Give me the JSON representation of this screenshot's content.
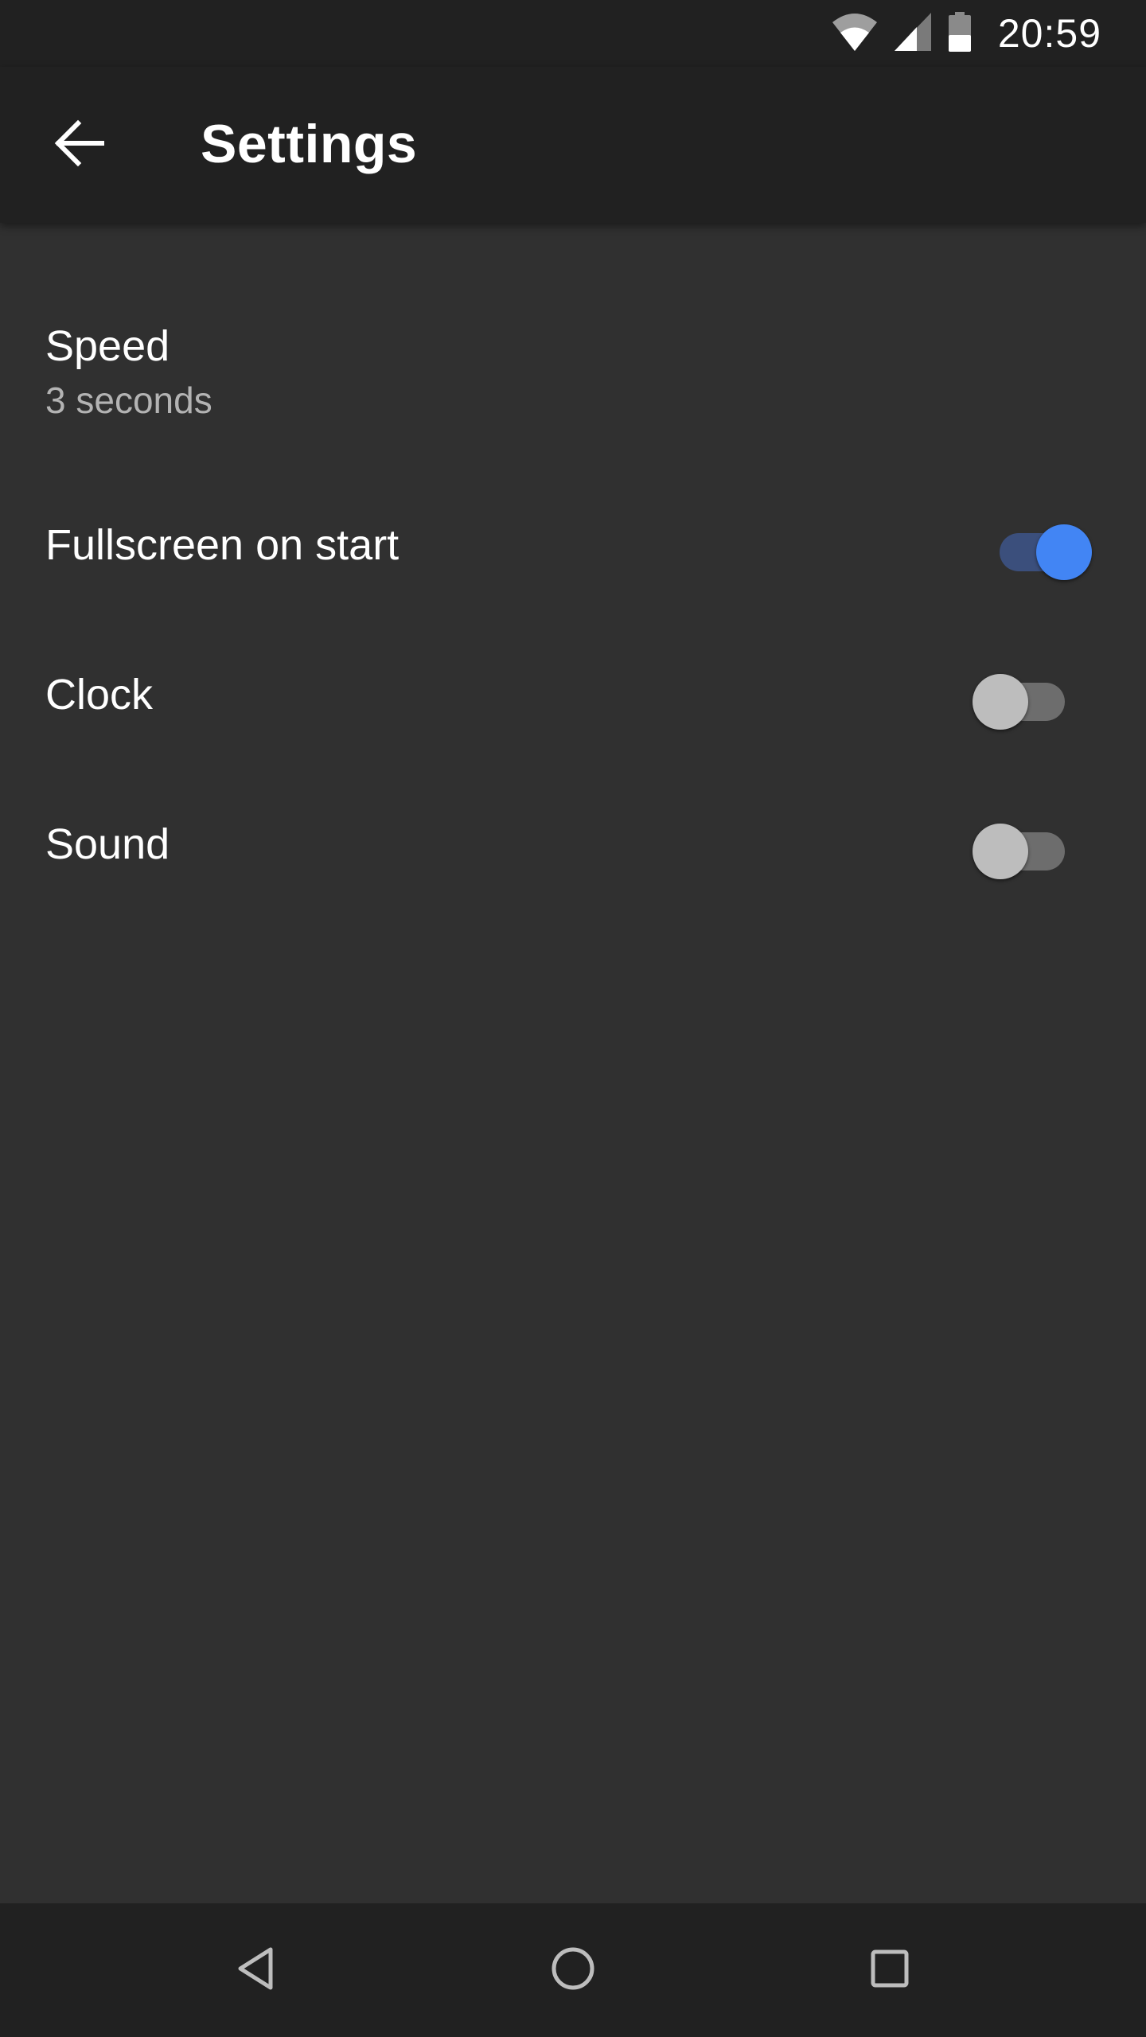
{
  "status_bar": {
    "time": "20:59",
    "icons": [
      "wifi-icon",
      "cellular-signal-icon",
      "battery-icon"
    ]
  },
  "app_bar": {
    "back_icon": "arrow-back-icon",
    "title": "Settings"
  },
  "settings": {
    "speed": {
      "title": "Speed",
      "summary": "3 seconds"
    },
    "fullscreen_on_start": {
      "title": "Fullscreen on start",
      "enabled": true
    },
    "clock": {
      "title": "Clock",
      "enabled": false
    },
    "sound": {
      "title": "Sound",
      "enabled": false
    }
  },
  "nav_bar": {
    "icons": [
      "nav-back-icon",
      "nav-home-icon",
      "nav-recents-icon"
    ]
  },
  "colors": {
    "background": "#303030",
    "bars": "#212121",
    "accent": "#4285f4",
    "accent_track": "#3b4f7c",
    "switch_off_thumb": "#bdbdbd",
    "switch_off_track": "#6d6d6d",
    "text_primary": "#ffffff",
    "text_secondary": "#b3b3b3"
  }
}
